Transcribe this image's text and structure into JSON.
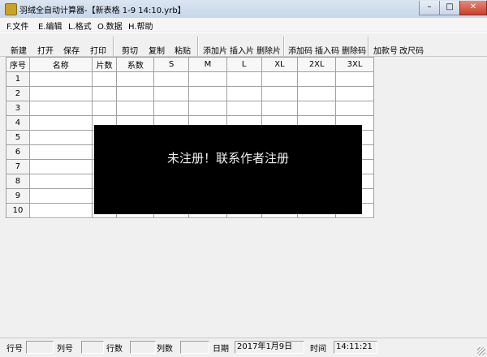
{
  "window": {
    "title": "羽绒全自动计算器-【新表格 1-9 14:10.yrb】",
    "minimize": "–",
    "maximize": "□",
    "close": "✕"
  },
  "menu": [
    "F.文件",
    "E.编辑",
    "L.格式",
    "O.数据",
    "H.帮助"
  ],
  "toolbar": {
    "group1": [
      "新建",
      "打开",
      "保存",
      "打印"
    ],
    "group2": [
      "剪切",
      "复制",
      "粘贴"
    ],
    "group3": [
      "添加片",
      "插入片",
      "删除片"
    ],
    "group4": [
      "添加码",
      "插入码",
      "删除码"
    ],
    "group5": [
      "加款号",
      "改尺码"
    ]
  },
  "grid": {
    "columns": [
      "序号",
      "名称",
      "片数",
      "系数",
      "S",
      "M",
      "L",
      "XL",
      "2XL",
      "3XL"
    ],
    "rows": [
      "1",
      "2",
      "3",
      "4",
      "5",
      "6",
      "7",
      "8",
      "9",
      "10"
    ]
  },
  "overlay": {
    "message": "未注册！联系作者注册"
  },
  "statusbar": {
    "row_label": "行号",
    "col_label": "列号",
    "rows_label": "行数",
    "cols_label": "列数",
    "date_label": "日期",
    "date_value": "2017年1月9日",
    "time_label": "时间",
    "time_value": "14:11:21"
  }
}
